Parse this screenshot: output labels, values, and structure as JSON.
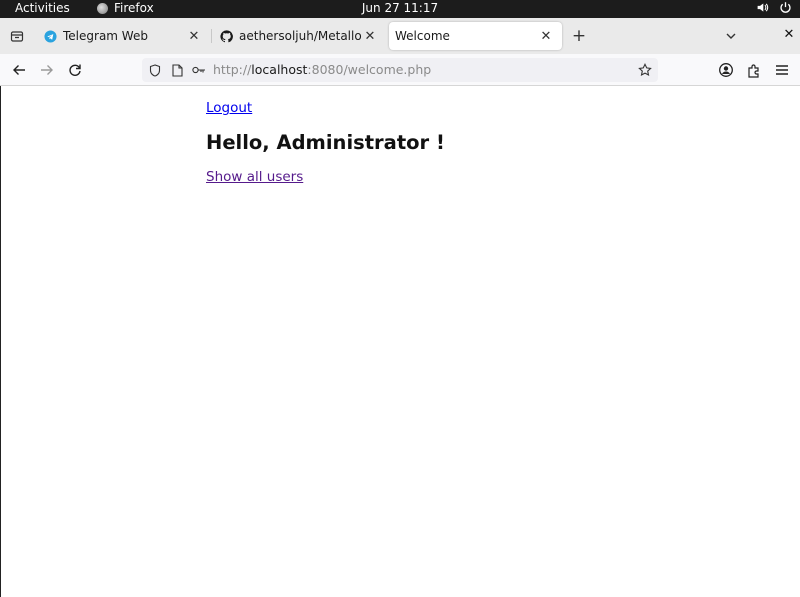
{
  "system_bar": {
    "activities": "Activities",
    "app_name": "Firefox",
    "clock": "Jun 27  11:17",
    "volume_icon": "speaker-icon",
    "power_icon": "power-icon"
  },
  "tabs": [
    {
      "title": "Telegram Web",
      "icon": "telegram-icon",
      "active": false
    },
    {
      "title": "aethersoljuh/Metallov_",
      "icon": "github-icon",
      "active": false
    },
    {
      "title": "Welcome",
      "icon": "",
      "active": true
    }
  ],
  "address_bar": {
    "scheme": "http://",
    "host": "localhost",
    "rest": ":8080/welcome.php"
  },
  "page": {
    "logout_link": "Logout",
    "greeting": "Hello, Administrator !",
    "show_users_link": "Show all users"
  },
  "colors": {
    "link": "#0000ee",
    "visited_link": "#551a8b",
    "system_bar_bg": "#1c1c1c",
    "tabbar_bg": "#eaeaea"
  }
}
